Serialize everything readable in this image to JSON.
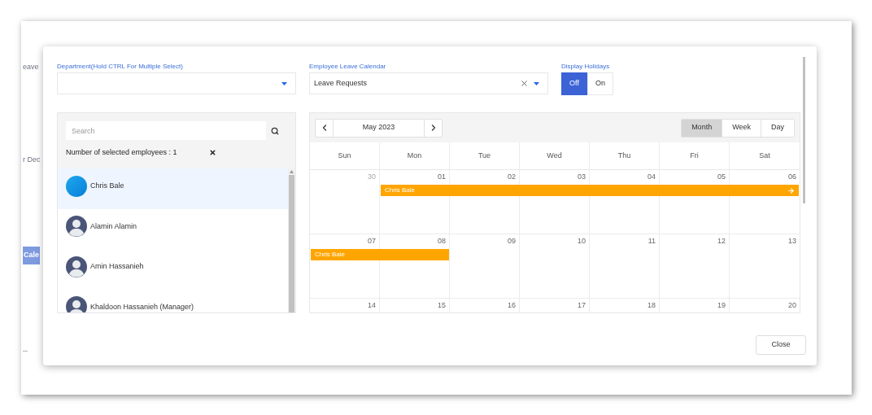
{
  "background": {
    "fragments": [
      "eave",
      "r Dec",
      "Cale",
      "--"
    ]
  },
  "department": {
    "label": "Department(Hold CTRL For Multiple Select)"
  },
  "calendar_select": {
    "label": "Employee Leave Calendar",
    "value": "Leave Requests"
  },
  "display_holidays": {
    "label": "Display Holidays",
    "options": [
      {
        "label": "Off",
        "selected": true
      },
      {
        "label": "On",
        "selected": false
      }
    ]
  },
  "employee_panel": {
    "search": {
      "placeholder": "Search"
    },
    "selected_count": "Number of selected employees : 1",
    "employees": [
      {
        "name": "Chris Bale",
        "selected": true,
        "kind": "photo"
      },
      {
        "name": "Alamin Alamin",
        "selected": false,
        "kind": "default"
      },
      {
        "name": "Amin Hassanieh",
        "selected": false,
        "kind": "default"
      },
      {
        "name": "Khaldoon Hassanieh (Manager)",
        "selected": false,
        "kind": "default"
      }
    ]
  },
  "calendar": {
    "title": "May 2023",
    "views": [
      {
        "label": "Month",
        "selected": true
      },
      {
        "label": "Week",
        "selected": false
      },
      {
        "label": "Day",
        "selected": false
      }
    ],
    "weekdays": [
      "Sun",
      "Mon",
      "Tue",
      "Wed",
      "Thu",
      "Fri",
      "Sat"
    ],
    "weeks": [
      {
        "days": [
          {
            "label": "30",
            "muted": true
          },
          {
            "label": "01",
            "muted": false
          },
          {
            "label": "02",
            "muted": false
          },
          {
            "label": "03",
            "muted": false
          },
          {
            "label": "04",
            "muted": false
          },
          {
            "label": "05",
            "muted": false
          },
          {
            "label": "06",
            "muted": false
          }
        ],
        "events": [
          {
            "title": "Chris Bale",
            "continues": true
          }
        ]
      },
      {
        "days": [
          {
            "label": "07",
            "muted": false
          },
          {
            "label": "08",
            "muted": false
          },
          {
            "label": "09",
            "muted": false
          },
          {
            "label": "10",
            "muted": false
          },
          {
            "label": "11",
            "muted": false
          },
          {
            "label": "12",
            "muted": false
          },
          {
            "label": "13",
            "muted": false
          }
        ],
        "events": [
          {
            "title": "Chris Bale",
            "continues": false
          }
        ]
      },
      {
        "days": [
          {
            "label": "14",
            "muted": false
          },
          {
            "label": "15",
            "muted": false
          },
          {
            "label": "16",
            "muted": false
          },
          {
            "label": "17",
            "muted": false
          },
          {
            "label": "18",
            "muted": false
          },
          {
            "label": "19",
            "muted": false
          },
          {
            "label": "20",
            "muted": false
          }
        ]
      }
    ]
  },
  "close_button": "Close"
}
